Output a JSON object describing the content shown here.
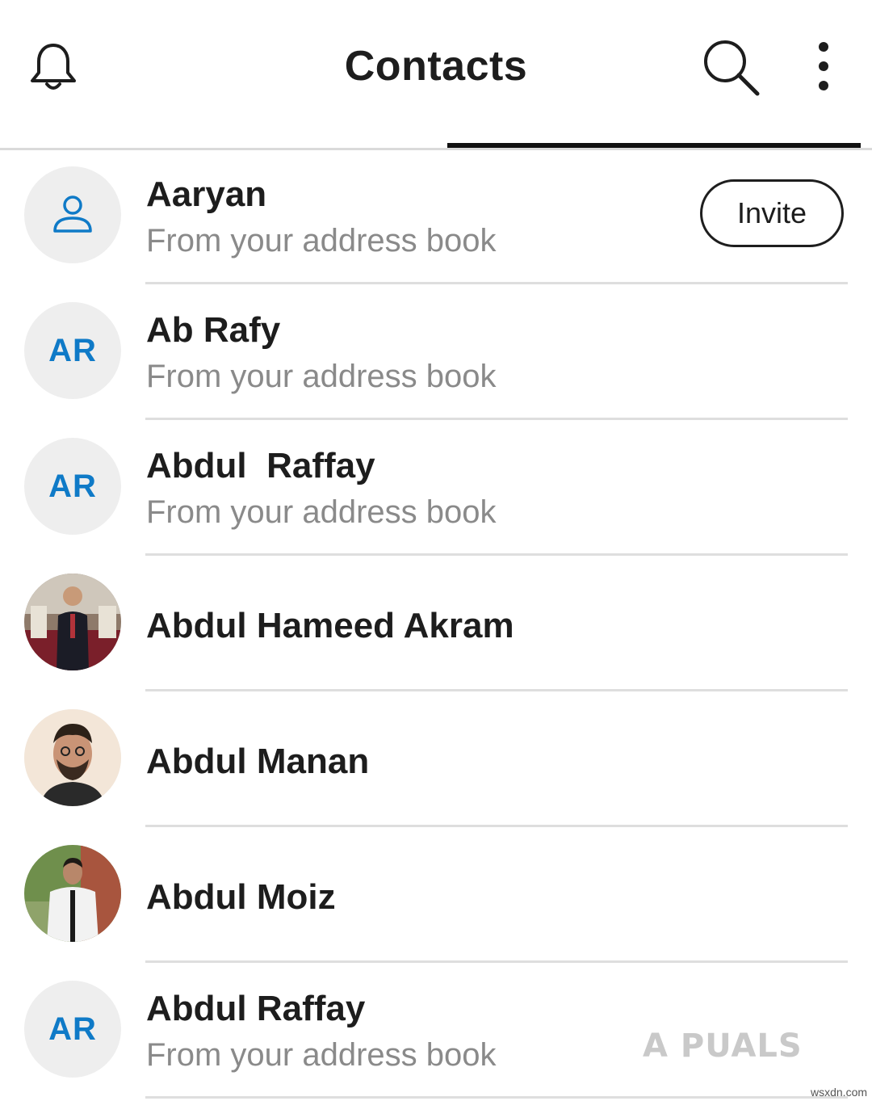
{
  "header": {
    "title": "Contacts",
    "icons": {
      "left": "bell-icon",
      "search": "search-icon",
      "more": "more-vertical-icon"
    }
  },
  "colors": {
    "accent_blue": "#0f7ac7",
    "text": "#1d1d1d",
    "sub_text": "#8a8a8a",
    "avatar_bg": "#eeeeee"
  },
  "contacts": [
    {
      "name": "Aaryan",
      "subtitle": "From your address book",
      "avatar": "person-icon",
      "action": "Invite"
    },
    {
      "name": "Ab Rafy",
      "subtitle": "From your address book",
      "initials": "AR"
    },
    {
      "name": "Abdul  Raffay",
      "subtitle": "From your address book",
      "initials": "AR"
    },
    {
      "name": "Abdul Hameed Akram",
      "avatar": "photo"
    },
    {
      "name": "Abdul Manan",
      "avatar": "photo"
    },
    {
      "name": "Abdul Moiz",
      "avatar": "photo"
    },
    {
      "name": "Abdul Raffay",
      "subtitle": "From your address book",
      "initials": "AR"
    }
  ],
  "watermark": "A PUALS",
  "site": "wsxdn.com"
}
